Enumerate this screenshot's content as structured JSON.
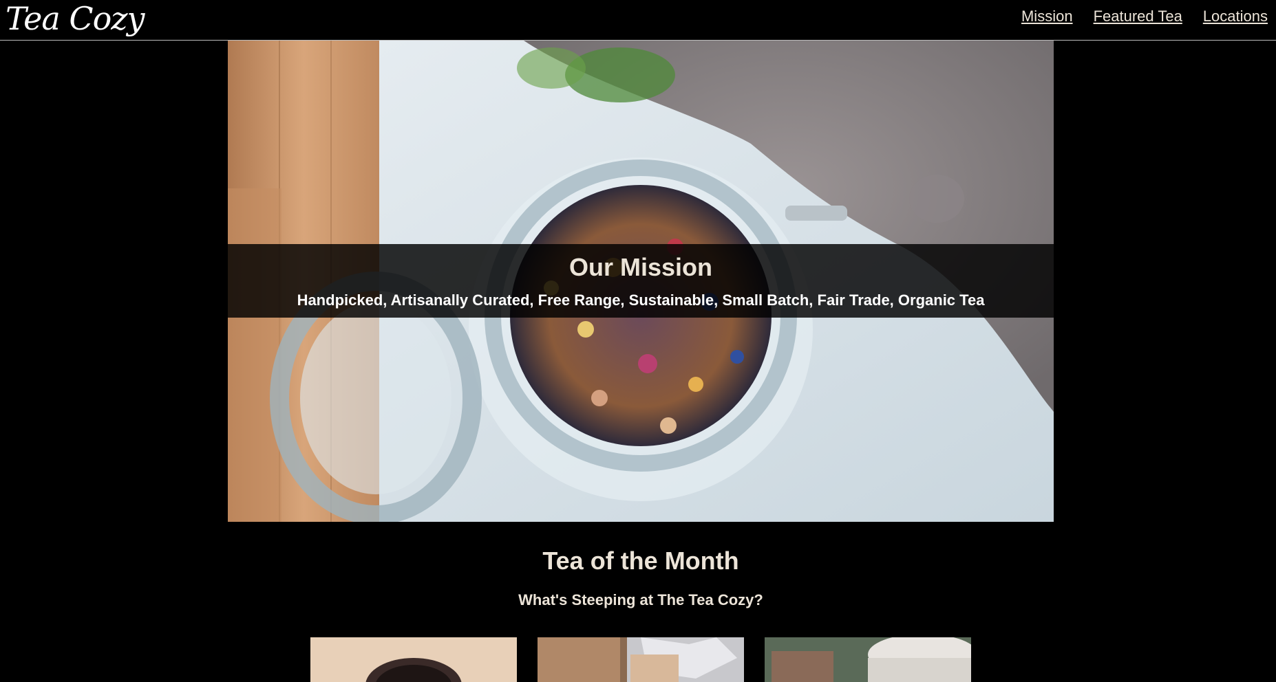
{
  "header": {
    "logo": "Tea Cozy",
    "nav": [
      {
        "label": "Mission"
      },
      {
        "label": "Featured Tea"
      },
      {
        "label": "Locations"
      }
    ]
  },
  "mission": {
    "title": "Our Mission",
    "subtitle": "Handpicked, Artisanally Curated, Free Range, Sustainable, Small Batch, Fair Trade, Organic Tea"
  },
  "tea_of_month": {
    "title": "Tea of the Month",
    "subtitle": "What's Steeping at The Tea Cozy?"
  },
  "colors": {
    "background": "#000000",
    "text": "#ece4d8",
    "nav_border": "#bdbdbd"
  }
}
